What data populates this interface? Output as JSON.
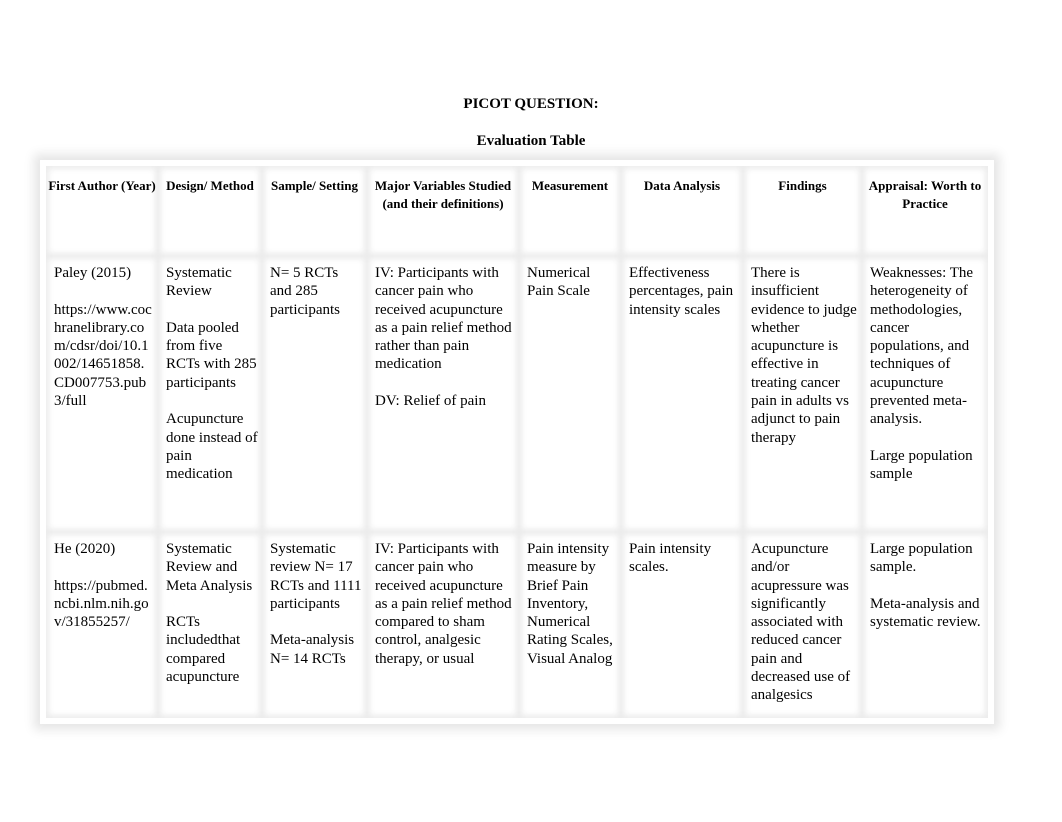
{
  "document": {
    "title": "PICOT QUESTION:",
    "subtitle": "Evaluation Table"
  },
  "table": {
    "headers": [
      "First Author (Year)",
      "Design/ Method",
      "Sample/ Setting",
      "Major Variables Studied (and their definitions)",
      "Measurement",
      "Data Analysis",
      "Findings",
      "Appraisal: Worth to Practice"
    ],
    "rows": [
      {
        "author": "Paley (2015)",
        "url": "https://www.cochranelibrary.com/cdsr/doi/10.1002/14651858.CD007753.pub3/full",
        "design": [
          "Systematic Review",
          "Data pooled from five RCTs with 285 participants",
          "Acupuncture done instead of pain medication"
        ],
        "sample": [
          "N= 5 RCTs and 285 participants"
        ],
        "variables": [
          "IV: Participants with cancer pain who received acupuncture as a pain relief method rather than pain medication",
          "DV: Relief of pain"
        ],
        "measurement": [
          "Numerical Pain Scale"
        ],
        "analysis": [
          "Effectiveness percentages, pain intensity scales"
        ],
        "findings": [
          "There is insufficient evidence to judge whether acupuncture is effective in treating cancer pain in adults vs adjunct to pain therapy"
        ],
        "appraisal": [
          "Weaknesses: The heterogeneity of methodologies, cancer populations, and techniques of acupuncture prevented meta-analysis.",
          "Large population sample"
        ]
      },
      {
        "author": "He (2020)",
        "url": "https://pubmed.ncbi.nlm.nih.gov/31855257/",
        "design": [
          "Systematic Review and Meta Analysis",
          "RCTs includedthat compared acupuncture"
        ],
        "sample": [
          "Systematic review N= 17 RCTs and 1111 participants",
          "Meta-analysis N= 14 RCTs"
        ],
        "variables": [
          "IV: Participants with cancer pain who received acupuncture as a pain relief method compared to sham control, analgesic therapy, or usual"
        ],
        "measurement": [
          "Pain intensity measure by Brief Pain Inventory, Numerical Rating Scales, Visual Analog"
        ],
        "analysis": [
          "Pain intensity scales."
        ],
        "findings": [
          "Acupuncture and/or acupressure was significantly associated with reduced cancer pain and decreased use of analgesics"
        ],
        "appraisal": [
          "Large population sample.",
          "Meta-analysis and systematic review."
        ]
      }
    ]
  }
}
